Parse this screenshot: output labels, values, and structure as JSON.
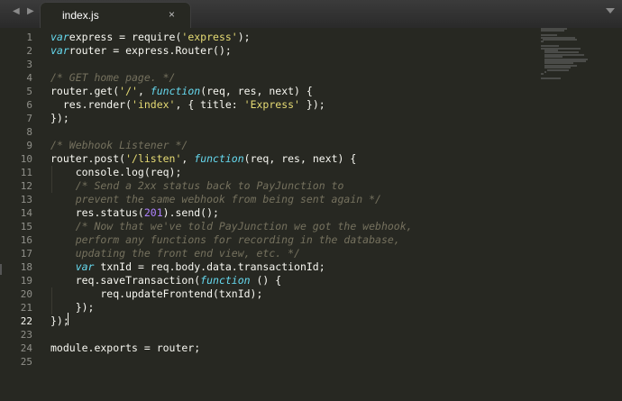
{
  "tabbar": {
    "nav_left": "◀",
    "nav_right": "▶",
    "tab_title": "index.js",
    "tab_close": "×",
    "dropdown_icon": "chevron-down-icon"
  },
  "editor": {
    "active_line": 22,
    "lines": [
      {
        "n": "1"
      },
      {
        "n": "2"
      },
      {
        "n": "3"
      },
      {
        "n": "4"
      },
      {
        "n": "5"
      },
      {
        "n": "6"
      },
      {
        "n": "7"
      },
      {
        "n": "8"
      },
      {
        "n": "9"
      },
      {
        "n": "10"
      },
      {
        "n": "11"
      },
      {
        "n": "12"
      },
      {
        "n": "13"
      },
      {
        "n": "14"
      },
      {
        "n": "15"
      },
      {
        "n": "16"
      },
      {
        "n": "17"
      },
      {
        "n": "18"
      },
      {
        "n": "19"
      },
      {
        "n": "20"
      },
      {
        "n": "21"
      },
      {
        "n": "22"
      },
      {
        "n": "23"
      },
      {
        "n": "24"
      },
      {
        "n": "25"
      }
    ],
    "code": [
      [
        [
          "kw",
          "var"
        ],
        [
          "",
          "express = require("
        ],
        [
          "st",
          "'express'"
        ],
        [
          "",
          ");"
        ]
      ],
      [
        [
          "kw",
          "var"
        ],
        [
          "",
          "router = express.Router();"
        ]
      ],
      [],
      [
        [
          "cm",
          "/* GET home page. */"
        ]
      ],
      [
        [
          "",
          "router.get("
        ],
        [
          "st",
          "'/'"
        ],
        [
          "",
          ", "
        ],
        [
          "kw",
          "function"
        ],
        [
          "",
          "(req, res, next) {"
        ]
      ],
      [
        [
          "",
          "  res.render("
        ],
        [
          "st",
          "'index'"
        ],
        [
          "",
          ", { title: "
        ],
        [
          "st",
          "'Express'"
        ],
        [
          "",
          " });"
        ]
      ],
      [
        [
          "",
          "});"
        ]
      ],
      [],
      [
        [
          "cm",
          "/* Webhook Listener */"
        ]
      ],
      [
        [
          "",
          "router.post("
        ],
        [
          "st",
          "'/listen'"
        ],
        [
          "",
          ", "
        ],
        [
          "kw",
          "function"
        ],
        [
          "",
          "(req, res, next) {"
        ]
      ],
      [
        [
          "",
          "    console.log(req);"
        ]
      ],
      [
        [
          "cm",
          "    /* Send a 2xx status back to PayJunction to"
        ]
      ],
      [
        [
          "cm",
          "    prevent the same webhook from being sent again */"
        ]
      ],
      [
        [
          "",
          "    res.status("
        ],
        [
          "nm",
          "201"
        ],
        [
          "",
          ").send();"
        ]
      ],
      [
        [
          "cm",
          "    /* Now that we've told PayJunction we got the webhook,"
        ]
      ],
      [
        [
          "cm",
          "    perform any functions for recording in the database,"
        ]
      ],
      [
        [
          "cm",
          "    updating the front end view, etc. */"
        ]
      ],
      [
        [
          "",
          "    "
        ],
        [
          "kw",
          "var"
        ],
        [
          "",
          " txnId = req.body.data.transactionId;"
        ]
      ],
      [
        [
          "",
          "    req.saveTransaction("
        ],
        [
          "kw",
          "function"
        ],
        [
          "",
          " () {"
        ]
      ],
      [
        [
          "",
          "        req.updateFrontend(txnId);"
        ]
      ],
      [
        [
          "",
          "    });"
        ]
      ],
      [
        [
          "",
          "});"
        ]
      ],
      [],
      [
        [
          "",
          "module.exports = router;"
        ]
      ],
      []
    ]
  },
  "colors": {
    "background": "#272822",
    "keyword": "#66d9ef",
    "string": "#e6db74",
    "number": "#ae81ff",
    "comment": "#75715e",
    "text": "#f8f8f2",
    "line_number": "#90908a"
  }
}
